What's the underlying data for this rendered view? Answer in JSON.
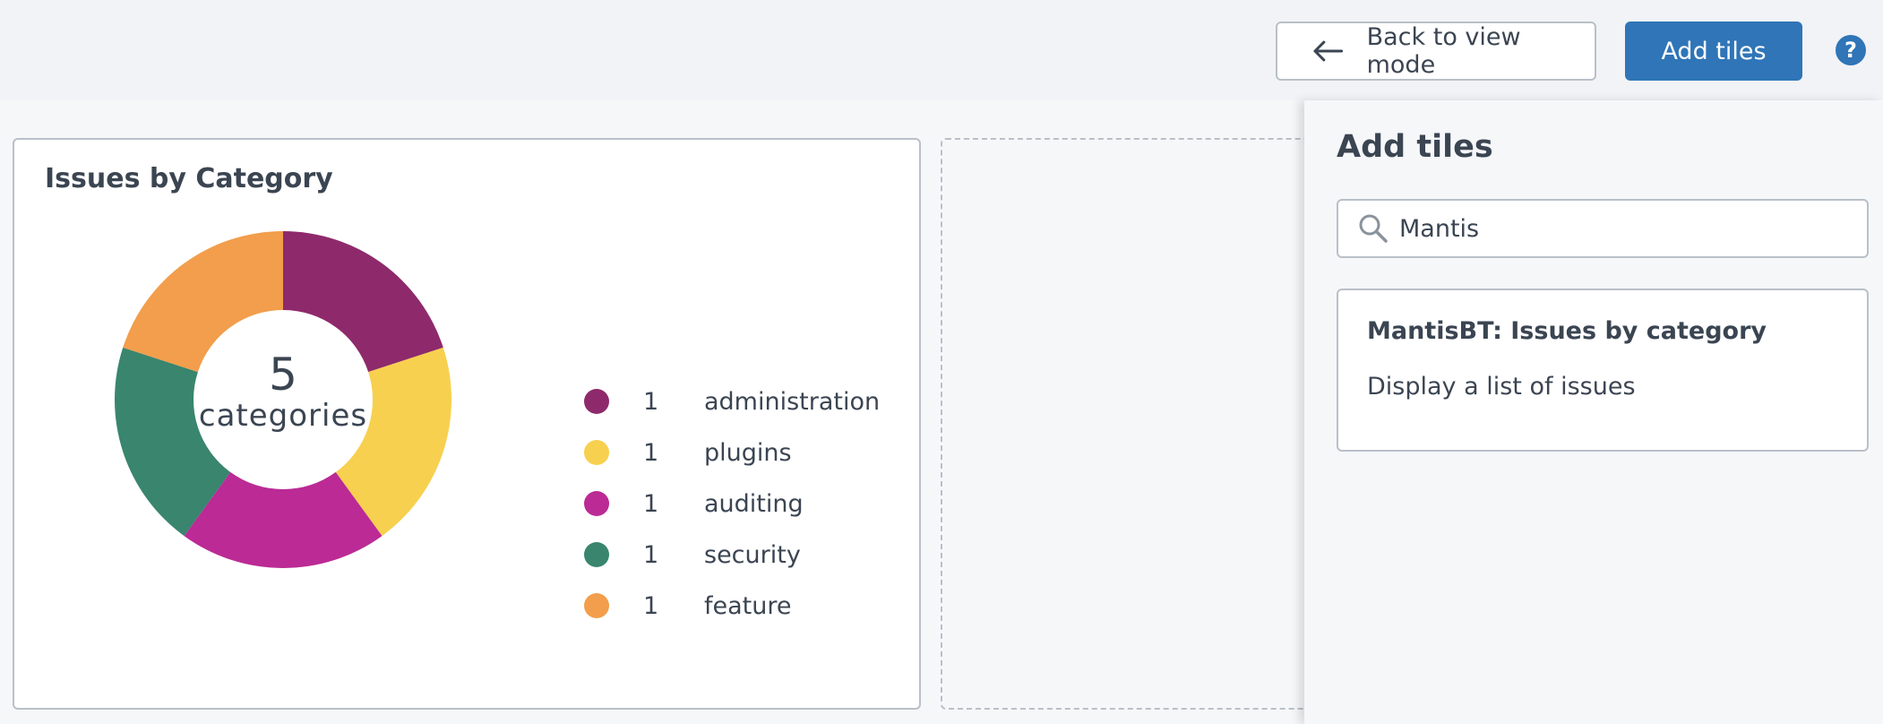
{
  "toolbar": {
    "back_label": "Back to view mode",
    "add_tiles_label": "Add tiles",
    "help_label": "?"
  },
  "tile": {
    "title": "Issues by Category",
    "center_count": "5",
    "center_unit": "categories"
  },
  "chart_data": {
    "type": "pie",
    "categories": [
      "administration",
      "plugins",
      "auditing",
      "security",
      "feature"
    ],
    "values": [
      1,
      1,
      1,
      1,
      1
    ],
    "colors": [
      "#8e2a6b",
      "#f7d04f",
      "#bb2a95",
      "#39856e",
      "#f29e4c"
    ]
  },
  "panel": {
    "title": "Add tiles",
    "search": {
      "value": "Mantis",
      "icon": "search-icon"
    },
    "results": [
      {
        "title": "MantisBT: Issues by category",
        "description": "Display a list of issues"
      }
    ]
  },
  "icons": {
    "back": "arrow-left-icon",
    "help": "help-icon",
    "search": "search-icon"
  },
  "colors": {
    "primary": "#2f75b7",
    "border": "#b9c0c8",
    "text": "#3b4552"
  }
}
